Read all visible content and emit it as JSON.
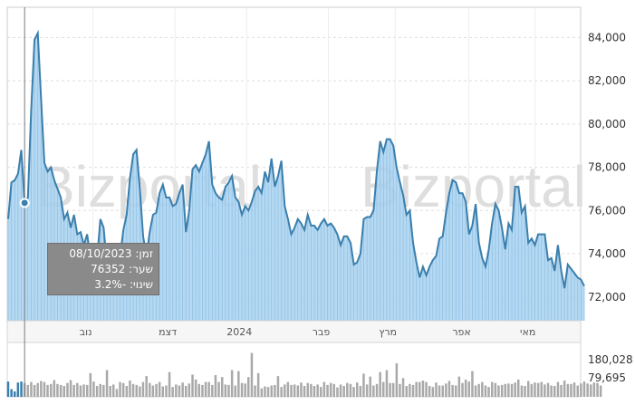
{
  "watermark": {
    "text_left": "Bizportal",
    "text_right": "Bizportal"
  },
  "tooltip": {
    "date_label": "זמן:",
    "date_value": "08/10/2023",
    "price_label": "שער:",
    "price_value": "76352",
    "change_label": "שינוי:",
    "change_value": "-3.2%"
  },
  "colors": {
    "line": "#3a7fad",
    "fill": "#a9d2f0",
    "volume": "#a9a9a9",
    "grid": "#dddddd",
    "tooltip_bg": "#8a8a8a"
  },
  "chart_data": [
    {
      "type": "area",
      "x_labels": [
        "נוב",
        "דצמ",
        "2024",
        "פבר",
        "מרץ",
        "אפר",
        "מאי"
      ],
      "y_ticks": [
        "72,000",
        "74,000",
        "76,000",
        "78,000",
        "80,000",
        "82,000",
        "84,000"
      ],
      "ylim": [
        70900,
        85400
      ],
      "grid": true,
      "crosshair_index": 5,
      "series": [
        {
          "values": [
            75.6,
            77.3,
            77.4,
            77.7,
            78.8,
            76.35,
            76.6,
            80.6,
            83.9,
            84.2,
            81.2,
            78.2,
            77.8,
            78.0,
            77.4,
            77.0,
            76.6,
            75.6,
            75.9,
            75.2,
            75.8,
            74.9,
            75.0,
            74.4,
            74.9,
            73.8,
            74.3,
            73.7,
            75.6,
            75.2,
            73.5,
            73.3,
            72.6,
            73.1,
            73.9,
            75.1,
            75.8,
            77.5,
            78.6,
            78.8,
            77.0,
            74.8,
            73.9,
            75.0,
            75.8,
            75.9,
            76.8,
            77.2,
            76.6,
            76.6,
            76.2,
            76.3,
            76.8,
            77.2,
            75.0,
            76.0,
            77.9,
            78.1,
            77.8,
            78.2,
            78.6,
            79.2,
            77.2,
            76.8,
            76.6,
            76.5,
            77.1,
            77.3,
            77.6,
            76.6,
            76.4,
            75.8,
            76.2,
            76.0,
            76.4,
            76.9,
            77.1,
            76.8,
            77.8,
            77.3,
            78.4,
            77.1,
            77.6,
            78.3,
            76.2,
            75.6,
            74.9,
            75.2,
            75.6,
            75.4,
            75.1,
            75.8,
            75.3,
            75.3,
            75.1,
            75.4,
            75.6,
            75.3,
            75.4,
            75.2,
            74.9,
            74.4,
            74.8,
            74.8,
            74.5,
            73.5,
            73.6,
            74.0,
            75.6,
            75.7,
            75.7,
            76.0,
            77.8,
            79.2,
            78.7,
            79.3,
            79.3,
            79.0,
            78.0,
            77.3,
            76.7,
            75.8,
            76.0,
            74.5,
            73.6,
            72.9,
            73.4,
            73.0,
            73.4,
            73.7,
            73.9,
            74.7,
            74.8,
            75.9,
            76.8,
            77.4,
            77.3,
            76.8,
            76.8,
            76.4,
            74.9,
            75.3,
            76.3,
            74.5,
            73.8,
            73.4,
            74.2,
            75.4,
            76.3,
            76.0,
            75.2,
            74.2,
            75.4,
            75.1,
            77.1,
            77.1,
            75.9,
            76.2,
            74.5,
            74.7,
            74.4,
            74.9,
            74.9,
            74.9,
            73.7,
            73.8,
            73.2,
            74.4,
            73.2,
            72.4,
            73.5,
            73.3,
            73.1,
            72.9,
            72.8,
            72.5
          ]
        }
      ]
    },
    {
      "type": "bar",
      "y_ticks": [
        "180,028",
        "79,695"
      ],
      "ylim": [
        0,
        220000
      ],
      "values": [
        62000,
        31000,
        22000,
        58000,
        62000,
        56000,
        48000,
        60000,
        48000,
        56000,
        64000,
        60000,
        48000,
        52000,
        68000,
        52000,
        48000,
        44000,
        56000,
        68000,
        48000,
        56000,
        46000,
        50000,
        48000,
        96000,
        62000,
        44000,
        52000,
        48000,
        108000,
        44000,
        50000,
        32000,
        60000,
        56000,
        44000,
        66000,
        52000,
        48000,
        42000,
        60000,
        84000,
        56000,
        46000,
        52000,
        60000,
        42000,
        46000,
        100000,
        40000,
        50000,
        46000,
        58000,
        44000,
        54000,
        90000,
        70000,
        52000,
        48000,
        60000,
        60000,
        48000,
        88000,
        60000,
        80000,
        50000,
        48000,
        108000,
        46000,
        104000,
        56000,
        54000,
        80000,
        178000,
        46000,
        96000,
        34000,
        42000,
        40000,
        46000,
        48000,
        84000,
        40000,
        50000,
        60000,
        48000,
        50000,
        46000,
        58000,
        44000,
        56000,
        52000,
        44000,
        50000,
        40000,
        60000,
        48000,
        56000,
        52000,
        38000,
        50000,
        44000,
        56000,
        52000,
        40000,
        58000,
        44000,
        94000,
        50000,
        82000,
        46000,
        52000,
        100000,
        60000,
        108000,
        56000,
        56000,
        136000,
        52000,
        76000,
        44000,
        52000,
        48000,
        60000,
        60000,
        66000,
        60000,
        44000,
        40000,
        58000,
        46000,
        46000,
        54000,
        64000,
        48000,
        46000,
        82000,
        56000,
        70000,
        62000,
        104000,
        46000,
        52000,
        60000,
        46000,
        40000,
        60000,
        56000,
        46000,
        48000,
        52000,
        54000,
        52000,
        58000,
        70000,
        46000,
        44000,
        64000,
        52000,
        58000,
        56000,
        60000,
        50000,
        56000,
        46000,
        44000,
        60000,
        48000,
        66000,
        52000,
        52000,
        58000,
        46000,
        54000,
        62000,
        54000,
        50000,
        58000,
        56000,
        46000
      ]
    }
  ]
}
